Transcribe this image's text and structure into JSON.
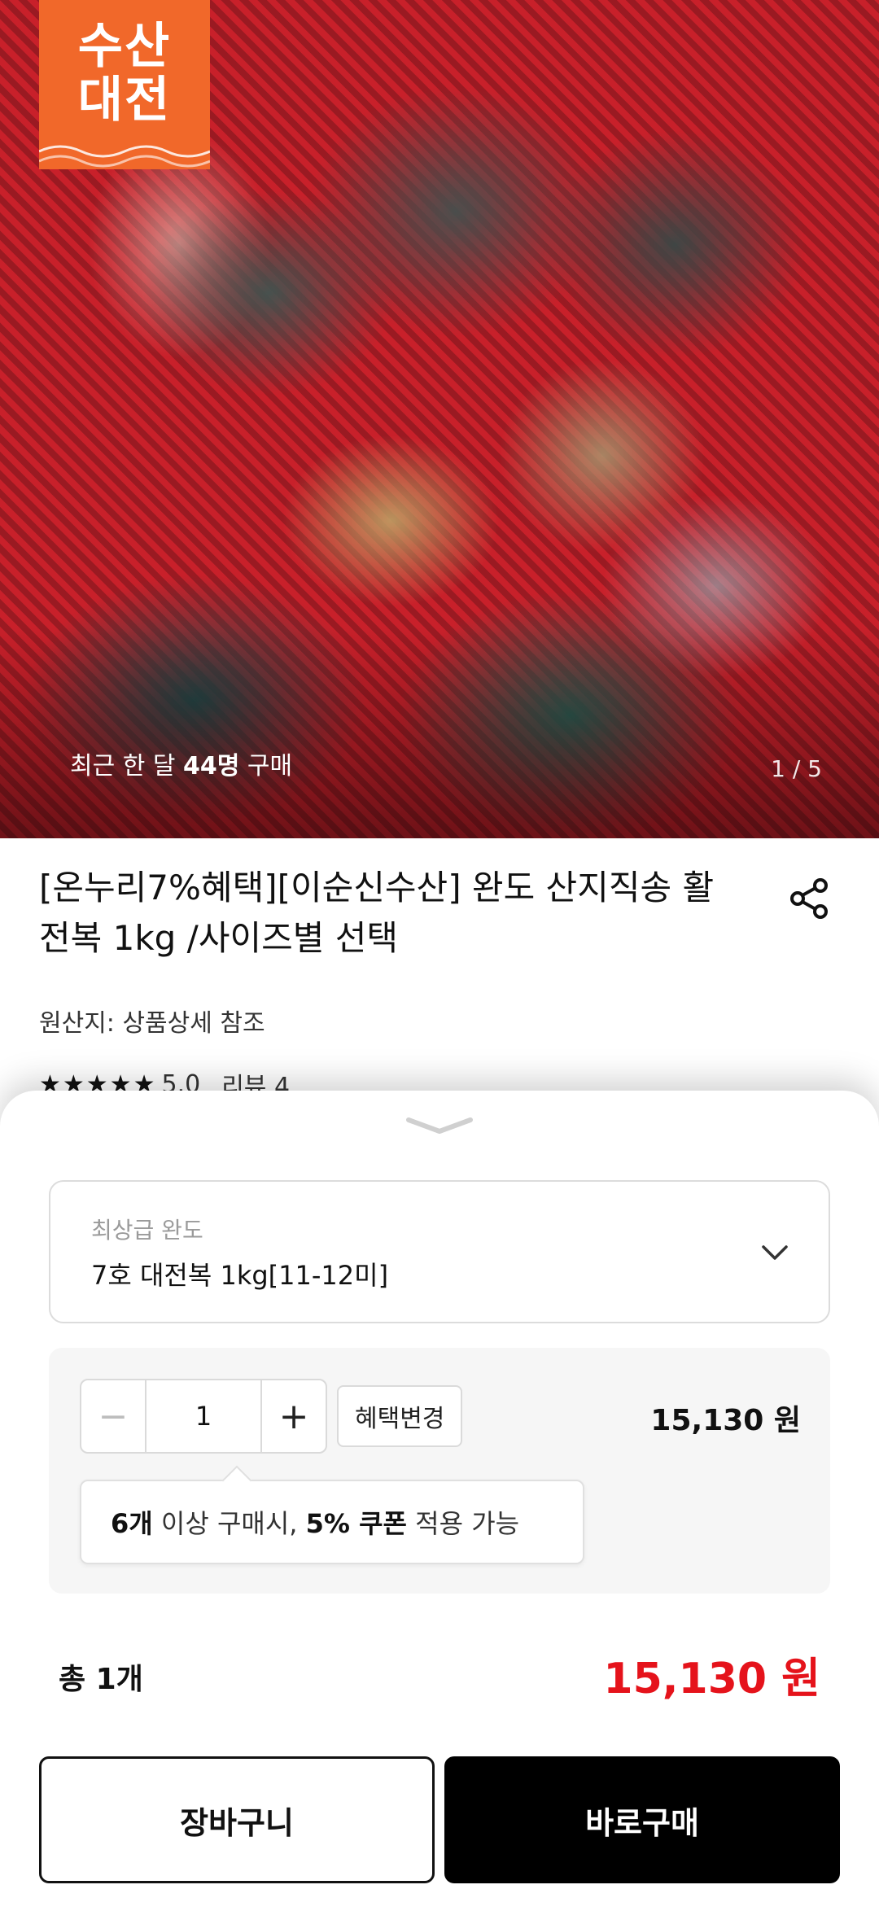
{
  "hero": {
    "brand_line1": "수산",
    "brand_line2": "대전",
    "brand_color": "#f1682a",
    "recent_buy_prefix": "최근 한 달 ",
    "recent_buy_count": "44명",
    "recent_buy_suffix": " 구매",
    "page_counter": "1 / 5"
  },
  "product": {
    "title": "[온누리7%혜택][이순신수산] 완도 산지직송 활 전복 1kg /사이즈별 선택",
    "origin": "원산지: 상품상세 참조",
    "stars": "★★★★★",
    "rating": "5.0",
    "reviews": "리뷰 4",
    "share_icon": "share-icon"
  },
  "sheet": {
    "option": {
      "category": "최상급 완도",
      "value": "7호 대전복 1kg[11-12미]"
    },
    "quantity": {
      "minus": "−",
      "value": "1",
      "plus": "+"
    },
    "benefit_change_label": "혜택변경",
    "line_price": "15,130 원",
    "coupon_tip": {
      "qty": "6개",
      "text1": " 이상 구매시, ",
      "discount": "5% 쿠폰",
      "text2": " 적용 가능"
    },
    "total_label": "총 1개",
    "total_price": "15,130 원",
    "total_price_color": "#e5131b",
    "cart_label": "장바구니",
    "buy_label": "바로구매"
  }
}
